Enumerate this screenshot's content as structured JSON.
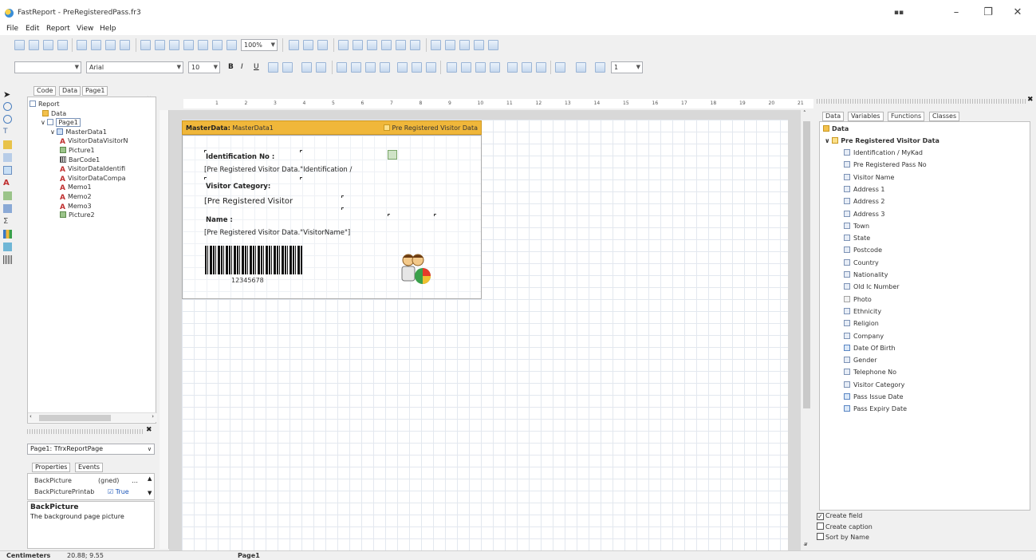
{
  "window": {
    "title": "FastReport - PreRegisteredPass.fr3",
    "buttons": [
      "▪▪",
      "–",
      "❐",
      "✕"
    ]
  },
  "menu": [
    "File",
    "Edit",
    "Report",
    "View",
    "Help"
  ],
  "toolbar": {
    "zoom": "100%",
    "font_name": "Arial",
    "font_size": "10",
    "style_buttons": [
      "B",
      "I",
      "U"
    ],
    "frame_width": "1"
  },
  "left_tabs": [
    "Code",
    "Data",
    "Page1"
  ],
  "tree": [
    {
      "label": "Report",
      "icon": "page",
      "depth": 0
    },
    {
      "label": "Data",
      "icon": "folder",
      "depth": 1
    },
    {
      "label": "Page1",
      "icon": "page",
      "depth": 1
    },
    {
      "label": "MasterData1",
      "icon": "band",
      "depth": 2
    },
    {
      "label": "VisitorDataVisitorN",
      "icon": "text",
      "depth": 3
    },
    {
      "label": "Picture1",
      "icon": "pic",
      "depth": 3
    },
    {
      "label": "BarCode1",
      "icon": "bar",
      "depth": 3
    },
    {
      "label": "VisitorDataIdentifi",
      "icon": "text",
      "depth": 3
    },
    {
      "label": "VisitorDataCompa",
      "icon": "text",
      "depth": 3
    },
    {
      "label": "Memo1",
      "icon": "text",
      "depth": 3
    },
    {
      "label": "Memo2",
      "icon": "text",
      "depth": 3
    },
    {
      "label": "Memo3",
      "icon": "text",
      "depth": 3
    },
    {
      "label": "Picture2",
      "icon": "pic",
      "depth": 3
    }
  ],
  "object_selector": "Page1: TfrxReportPage",
  "inspector": {
    "tabs": [
      "Properties",
      "Events"
    ],
    "rows": [
      {
        "name": "BackPicture",
        "value": "(gned)"
      },
      {
        "name": "BackPicturePrintab",
        "value": "True"
      }
    ],
    "desc_title": "BackPicture",
    "desc_text": "The background page picture"
  },
  "ruler": [
    "1",
    "2",
    "3",
    "4",
    "5",
    "6",
    "7",
    "8",
    "9",
    "10",
    "11",
    "12",
    "13",
    "14",
    "15",
    "16",
    "17",
    "18",
    "19",
    "20",
    "21"
  ],
  "band": {
    "title_prefix": "MasterData:",
    "title_name": "MasterData1",
    "dataset": "Pre Registered Visitor Data"
  },
  "memos": {
    "id_label": "Identification No :",
    "id_value": "[Pre Registered Visitor Data.\"Identification /",
    "category_label": "Visitor Category:",
    "category_value": "[Pre Registered Visitor",
    "name_label": "Name :",
    "name_value": "[Pre Registered Visitor Data.\"VisitorName\"]",
    "barcode_text": "12345678"
  },
  "right_tabs": [
    "Data",
    "Variables",
    "Functions",
    "Classes"
  ],
  "data_tree": {
    "root": "Data",
    "dataset": "Pre Registered Visitor Data",
    "fields": [
      {
        "label": "Identification / MyKad",
        "kind": "text"
      },
      {
        "label": "Pre Registered Pass No",
        "kind": "text"
      },
      {
        "label": "Visitor Name",
        "kind": "text"
      },
      {
        "label": "Address 1",
        "kind": "text"
      },
      {
        "label": "Address 2",
        "kind": "text"
      },
      {
        "label": "Address 3",
        "kind": "text"
      },
      {
        "label": "Town",
        "kind": "text"
      },
      {
        "label": "State",
        "kind": "text"
      },
      {
        "label": "Postcode",
        "kind": "text"
      },
      {
        "label": "Country",
        "kind": "text"
      },
      {
        "label": "Nationality",
        "kind": "text"
      },
      {
        "label": "Old Ic Number",
        "kind": "text"
      },
      {
        "label": "Photo",
        "kind": "photo"
      },
      {
        "label": "Ethnicity",
        "kind": "text"
      },
      {
        "label": "Religion",
        "kind": "text"
      },
      {
        "label": "Company",
        "kind": "text"
      },
      {
        "label": "Date Of Birth",
        "kind": "date"
      },
      {
        "label": "Gender",
        "kind": "text"
      },
      {
        "label": "Telephone No",
        "kind": "text"
      },
      {
        "label": "Visitor Category",
        "kind": "text"
      },
      {
        "label": "Pass Issue Date",
        "kind": "date"
      },
      {
        "label": "Pass Expiry Date",
        "kind": "date"
      }
    ]
  },
  "options": [
    {
      "label": "Create field",
      "checked": true
    },
    {
      "label": "Create caption",
      "checked": false
    },
    {
      "label": "Sort by Name",
      "checked": false
    }
  ],
  "status": {
    "units": "Centimeters",
    "coords": "20.88; 9.55",
    "page": "Page1"
  }
}
